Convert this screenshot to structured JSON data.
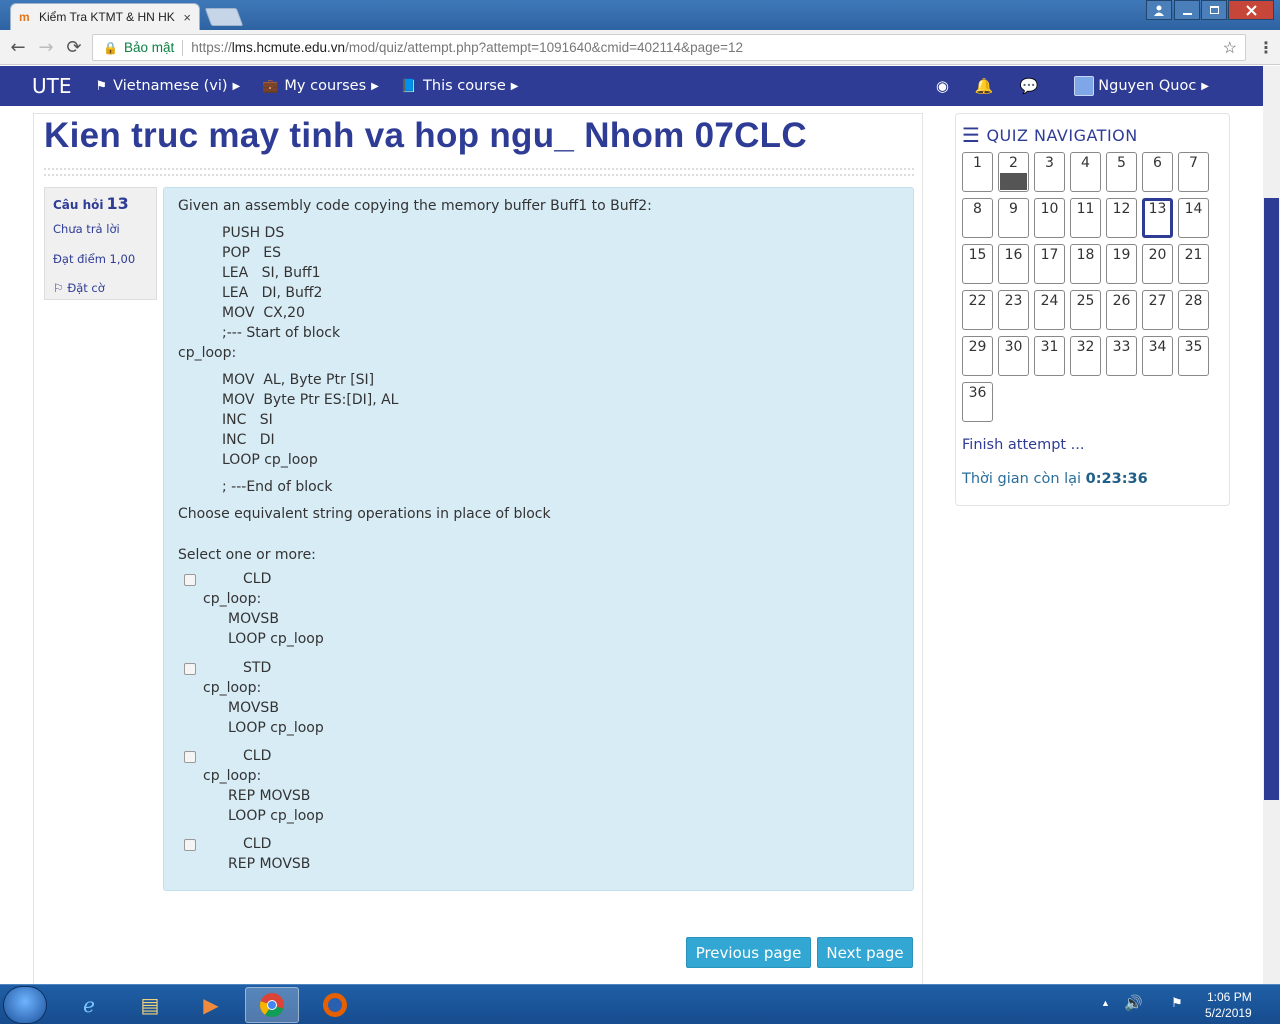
{
  "browser": {
    "tab_title": "Kiểm Tra KTMT & HN HK",
    "tab_close": "×",
    "secure_label": "Bảo mật",
    "url_scheme": "https://",
    "url_host": "lms.hcmute.edu.vn",
    "url_path": "/mod/quiz/attempt.php?attempt=1091640&cmid=402114&page=12"
  },
  "navbar": {
    "brand": "UTE",
    "language": "Vietnamese (vi)",
    "my_courses": "My courses",
    "this_course": "This course",
    "user_name": "Nguyen Quoc"
  },
  "page": {
    "title": "Kien truc may tinh va hop ngu_ Nhom 07CLC"
  },
  "question_info": {
    "label": "Câu hỏi",
    "number": "13",
    "status": "Chưa trả lời",
    "marks": "Đạt điểm 1,00",
    "flag": "Đặt cờ"
  },
  "question": {
    "intro": "Given an assembly code copying the memory buffer Buff1 to Buff2:",
    "code_top": [
      "PUSH DS",
      "POP   ES",
      "LEA   SI, Buff1",
      "LEA   DI, Buff2",
      "MOV  CX,20",
      ";--- Start of block"
    ],
    "label": "cp_loop:",
    "code_loop": [
      "MOV  AL, Byte Ptr [SI]",
      "MOV  Byte Ptr ES:[DI], AL",
      "INC   SI",
      "INC   DI",
      "LOOP cp_loop"
    ],
    "code_end": "; ---End of block",
    "prompt": "Choose equivalent string operations in place of block",
    "select_label": "Select one or more:",
    "options": [
      {
        "first": "CLD",
        "label": "cp_loop:",
        "lines": [
          "MOVSB",
          "LOOP cp_loop"
        ]
      },
      {
        "first": "STD",
        "label": "cp_loop:",
        "lines": [
          "MOVSB",
          "LOOP cp_loop"
        ]
      },
      {
        "first": "CLD",
        "label": "cp_loop:",
        "lines": [
          "REP MOVSB",
          "LOOP cp_loop"
        ]
      },
      {
        "first": "CLD",
        "lines": [
          "REP MOVSB"
        ]
      }
    ]
  },
  "buttons": {
    "previous": "Previous page",
    "next": "Next page"
  },
  "quiz_nav": {
    "title": "QUIZ NAVIGATION",
    "questions": [
      "1",
      "2",
      "3",
      "4",
      "5",
      "6",
      "7",
      "8",
      "9",
      "10",
      "11",
      "12",
      "13",
      "14",
      "15",
      "16",
      "17",
      "18",
      "19",
      "20",
      "21",
      "22",
      "23",
      "24",
      "25",
      "26",
      "27",
      "28",
      "29",
      "30",
      "31",
      "32",
      "33",
      "34",
      "35",
      "36"
    ],
    "answered": [
      "2"
    ],
    "current": "13",
    "finish": "Finish attempt ...",
    "time_label": "Thời gian còn lại",
    "time_value": "0:23:36"
  },
  "taskbar": {
    "time": "1:06 PM",
    "date": "5/2/2019"
  }
}
